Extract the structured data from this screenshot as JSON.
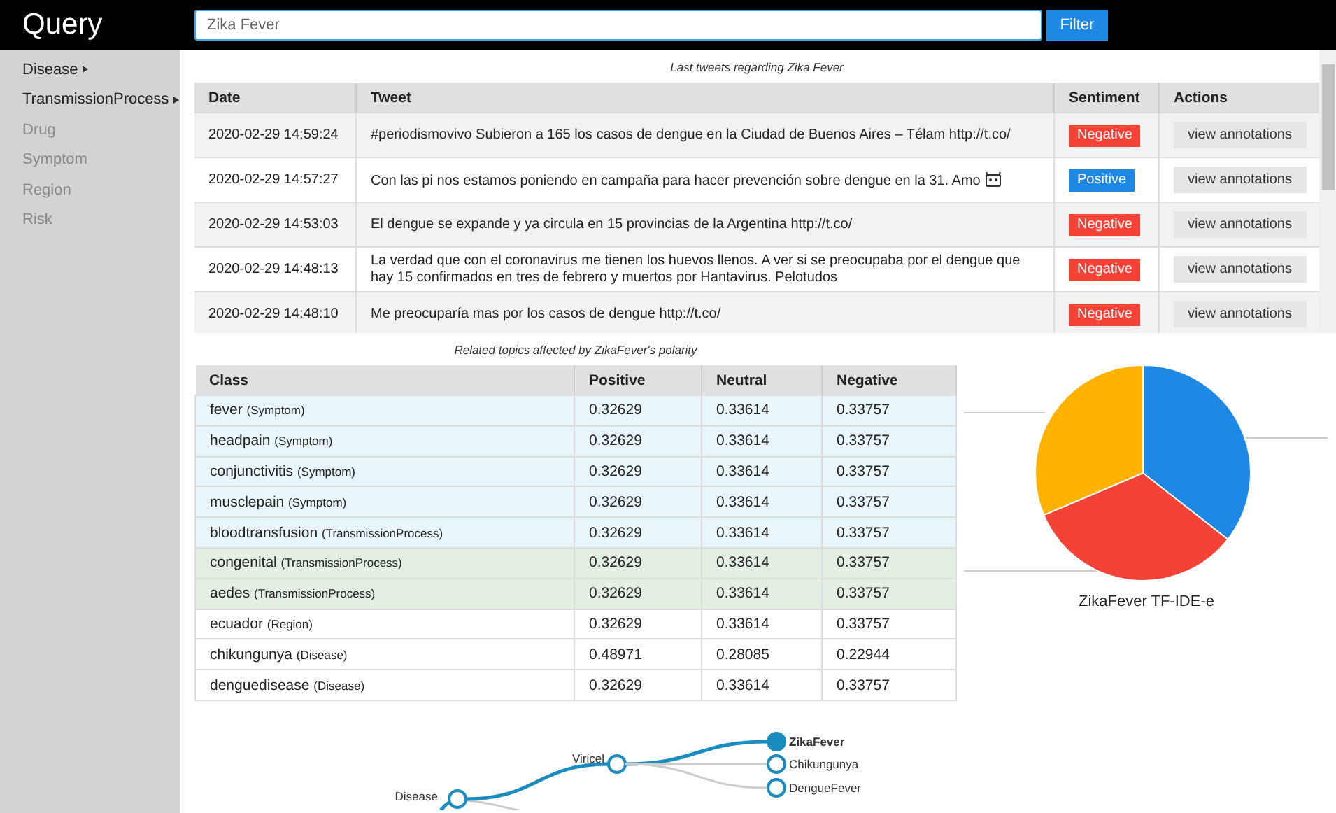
{
  "header": {
    "logo": "Query",
    "search": {
      "value": "Zika Fever"
    },
    "filter_button": "Filter"
  },
  "sidebar": {
    "items": [
      {
        "label": "Disease",
        "enabled": true,
        "expandable": true
      },
      {
        "label": "TransmissionProcess",
        "enabled": true,
        "expandable": true
      },
      {
        "label": "Drug",
        "enabled": false,
        "expandable": false
      },
      {
        "label": "Symptom",
        "enabled": false,
        "expandable": false
      },
      {
        "label": "Region",
        "enabled": false,
        "expandable": false
      },
      {
        "label": "Risk",
        "enabled": false,
        "expandable": false
      }
    ]
  },
  "tweets": {
    "caption": "Last tweets regarding Zika Fever",
    "columns": [
      "Date",
      "Tweet",
      "Sentiment",
      "Actions"
    ],
    "rows": [
      {
        "date": "2020-02-29 14:59:24",
        "tweet": "#periodismovivo Subieron a 165 los casos de dengue en la Ciudad de Buenos Aires – Télam http://t.co/",
        "emoji": false,
        "sentiment": {
          "label": "Negative",
          "kind": "negative"
        },
        "action": "view annotations"
      },
      {
        "date": "2020-02-29 14:57:27",
        "tweet": "Con las pi nos estamos poniendo en campaña para hacer prevención sobre dengue en la 31. Amo",
        "emoji": true,
        "sentiment": {
          "label": "Positive",
          "kind": "positive"
        },
        "action": "view annotations"
      },
      {
        "date": "2020-02-29 14:53:03",
        "tweet": "El dengue se expande y ya circula en 15 provincias de la Argentina http://t.co/",
        "emoji": false,
        "sentiment": {
          "label": "Negative",
          "kind": "negative"
        },
        "action": "view annotations"
      },
      {
        "date": "2020-02-29 14:48:13",
        "tweet": "La verdad que con el coronavirus me tienen los huevos llenos. A ver si se preocupaba por el dengue que hay 15 confirmados en tres de febrero y muertos por Hantavirus. Pelotudos",
        "emoji": false,
        "sentiment": {
          "label": "Negative",
          "kind": "negative"
        },
        "action": "view annotations"
      },
      {
        "date": "2020-02-29 14:48:10",
        "tweet": "Me preocuparía mas por los casos de dengue http://t.co/",
        "emoji": false,
        "sentiment": {
          "label": "Negative",
          "kind": "negative"
        },
        "action": "view annotations"
      }
    ]
  },
  "topics": {
    "caption": "Related topics affected by ZikaFever's polarity",
    "columns": [
      "Class",
      "Positive",
      "Neutral",
      "Negative"
    ],
    "rows": [
      {
        "name": "fever",
        "type": "(Symptom)",
        "color": "#e8f6fc",
        "positive": "0.32629",
        "neutral": "0.33614",
        "negative": "0.33757"
      },
      {
        "name": "headpain",
        "type": "(Symptom)",
        "color": "#e8f6fc",
        "positive": "0.32629",
        "neutral": "0.33614",
        "negative": "0.33757"
      },
      {
        "name": "conjunctivitis",
        "type": "(Symptom)",
        "color": "#e8f6fc",
        "positive": "0.32629",
        "neutral": "0.33614",
        "negative": "0.33757"
      },
      {
        "name": "musclepain",
        "type": "(Symptom)",
        "color": "#e8f6fc",
        "positive": "0.32629",
        "neutral": "0.33614",
        "negative": "0.33757"
      },
      {
        "name": "bloodtransfusion",
        "type": "(TransmissionProcess)",
        "color": "#e8f6fc",
        "positive": "0.32629",
        "neutral": "0.33614",
        "negative": "0.33757"
      },
      {
        "name": "congenital",
        "type": "(TransmissionProcess)",
        "color": "#e3efe3",
        "positive": "0.32629",
        "neutral": "0.33614",
        "negative": "0.33757"
      },
      {
        "name": "aedes",
        "type": "(TransmissionProcess)",
        "color": "#e3efe3",
        "positive": "0.32629",
        "neutral": "0.33614",
        "negative": "0.33757"
      },
      {
        "name": "ecuador",
        "type": "(Region)",
        "color": "#ffffff",
        "positive": "0.32629",
        "neutral": "0.33614",
        "negative": "0.33757"
      },
      {
        "name": "chikungunya",
        "type": "(Disease)",
        "color": "#ffffff",
        "positive": "0.48971",
        "neutral": "0.28085",
        "negative": "0.22944"
      },
      {
        "name": "denguedisease",
        "type": "(Disease)",
        "color": "#ffffff",
        "positive": "0.32629",
        "neutral": "0.33614",
        "negative": "0.33757"
      }
    ]
  },
  "pie": {
    "title": "ZikaFever TF-IDE-e"
  },
  "tree": {
    "label": "Disease",
    "selected": false,
    "children": [
      {
        "label": "Viricel",
        "selected": false,
        "children": [
          {
            "label": "ZikaFever",
            "selected": true
          },
          {
            "label": "Chikungunya",
            "selected": false
          },
          {
            "label": "DengueFever",
            "selected": false
          }
        ]
      }
    ]
  }
}
